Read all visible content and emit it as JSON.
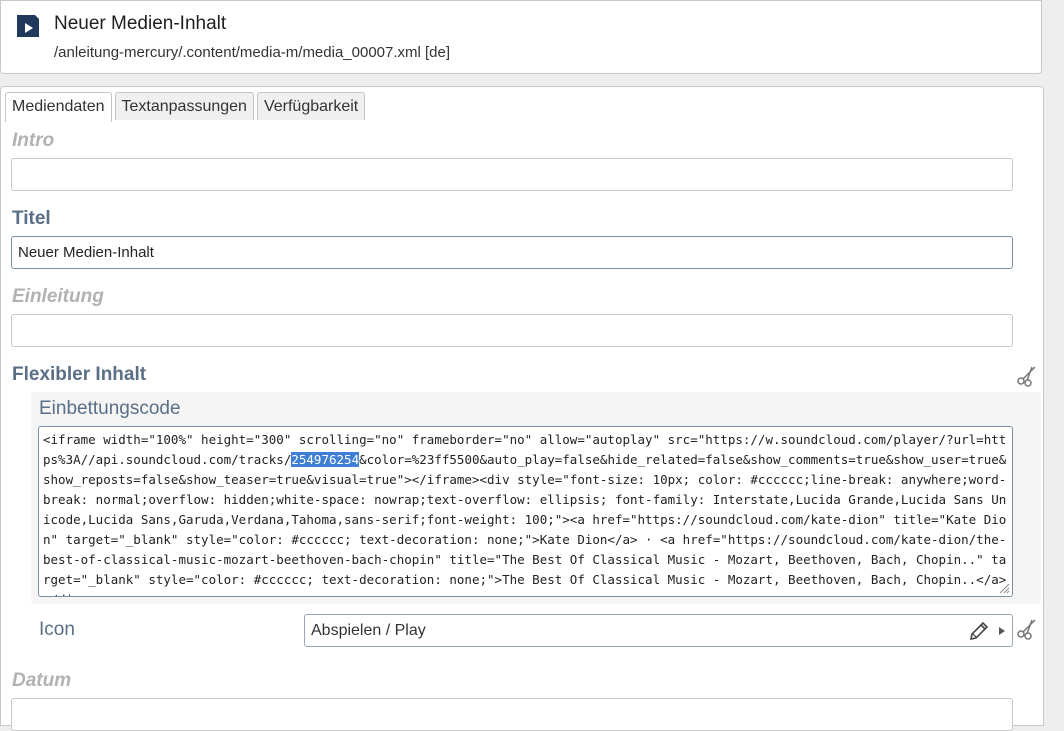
{
  "header": {
    "title": "Neuer Medien-Inhalt",
    "path": "/anleitung-mercury/.content/media-m/media_00007.xml [de]"
  },
  "tabs": [
    {
      "label": "Mediendaten",
      "active": true
    },
    {
      "label": "Textanpassungen",
      "active": false
    },
    {
      "label": "Verfügbarkeit",
      "active": false
    }
  ],
  "fields": {
    "intro": {
      "label": "Intro",
      "value": ""
    },
    "titel": {
      "label": "Titel",
      "value": "Neuer Medien-Inhalt"
    },
    "einleitung": {
      "label": "Einleitung",
      "value": ""
    },
    "flexibler_inhalt": {
      "label": "Flexibler Inhalt"
    },
    "einbettungscode": {
      "label": "Einbettungscode",
      "code_before": "<iframe width=\"100%\" height=\"300\" scrolling=\"no\" frameborder=\"no\" allow=\"autoplay\" src=\"https://w.soundcloud.com/player/?url=https%3A//api.soundcloud.com/tracks/",
      "code_selected": "254976254",
      "code_after": "&color=%23ff5500&auto_play=false&hide_related=false&show_comments=true&show_user=true&show_reposts=false&show_teaser=true&visual=true\"></iframe><div style=\"font-size: 10px; color: #cccccc;line-break: anywhere;word-break: normal;overflow: hidden;white-space: nowrap;text-overflow: ellipsis; font-family: Interstate,Lucida Grande,Lucida Sans Unicode,Lucida Sans,Garuda,Verdana,Tahoma,sans-serif;font-weight: 100;\"><a href=\"https://soundcloud.com/kate-dion\" title=\"Kate Dion\" target=\"_blank\" style=\"color: #cccccc; text-decoration: none;\">Kate Dion</a> · <a href=\"https://soundcloud.com/kate-dion/the-best-of-classical-music-mozart-beethoven-bach-chopin\" title=\"The Best Of Classical Music - Mozart, Beethoven, Bach, Chopin..\" target=\"_blank\" style=\"color: #cccccc; text-decoration: none;\">The Best Of Classical Music - Mozart, Beethoven, Bach, Chopin..</a></div>"
    },
    "icon": {
      "label": "Icon",
      "value": "Abspielen / Play"
    },
    "datum": {
      "label": "Datum",
      "value": ""
    }
  },
  "colors": {
    "label_filled": "#5a6f86",
    "label_empty": "#b2b2b2",
    "selection": "#3f7fd6",
    "app_icon": "#1f3a5a"
  }
}
